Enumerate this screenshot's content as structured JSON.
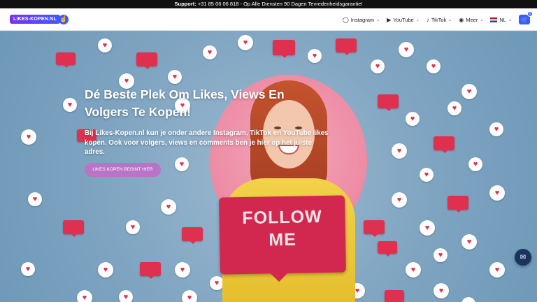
{
  "announcement": {
    "label": "Support:",
    "text": " +31 85 06 06 818 - Op Alle Diensten 90 Dagen Tevredenheidsgarantie!"
  },
  "header": {
    "logo_text": "LIKES-KOPEN.NL",
    "menu": [
      {
        "label": "Instagram",
        "icon": "instagram-icon"
      },
      {
        "label": "YouTube",
        "icon": "youtube-icon"
      },
      {
        "label": "TikTok",
        "icon": "tiktok-icon"
      },
      {
        "label": "Meer",
        "icon": "eye-icon"
      },
      {
        "label": "NL",
        "icon": "dutch-flag-icon"
      }
    ],
    "cart_count": "0"
  },
  "hero": {
    "headline": "Dé Beste Plek Om Likes, Views En Volgers Te Kopen!",
    "lead": "Bij Likes-Kopen.nl kun je onder andere Instagram, TikTok en YouTube likes kopen. Ook voor volgers, views en comments ben je hier op het juiste adres.",
    "cta_label": "LIKES KOPEN BEGINT HIER",
    "sign_line1": "FOLLOW",
    "sign_line2": "ME"
  },
  "colors": {
    "brand": "#3b5bff",
    "like_red": "#e0304f",
    "cta": "#b973c7",
    "chat": "#17355e"
  }
}
